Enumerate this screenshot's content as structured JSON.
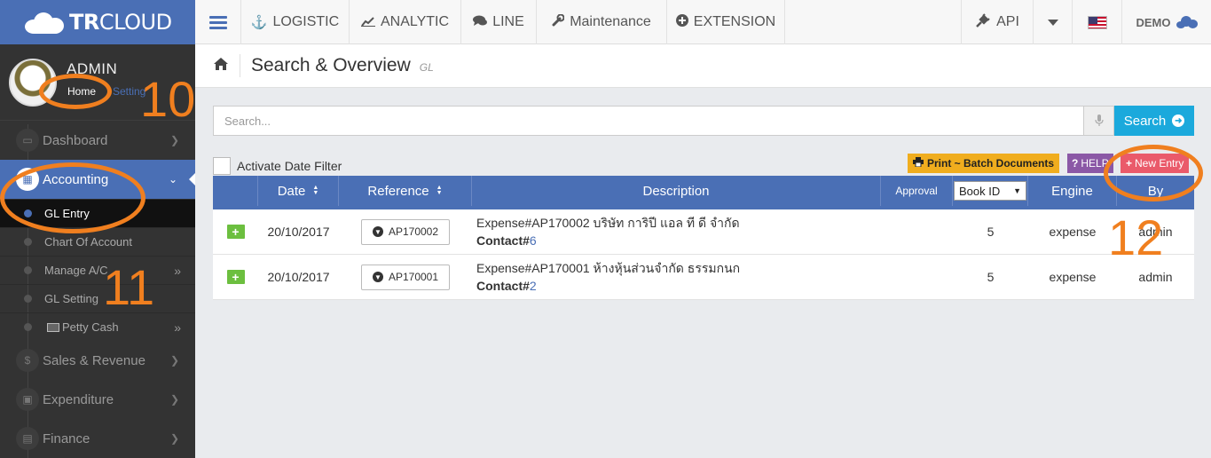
{
  "brand": {
    "name_bold": "TR",
    "name_rest": "CLOUD"
  },
  "topnav": {
    "items": [
      {
        "icon": "ship-icon",
        "label": "LOGISTIC"
      },
      {
        "icon": "chart-line-icon",
        "label": "ANALYTIC"
      },
      {
        "icon": "comments-icon",
        "label": "LINE"
      },
      {
        "icon": "wrench-icon",
        "label": "Maintenance"
      },
      {
        "icon": "plus-circle-icon",
        "label": "EXTENSION"
      }
    ],
    "api_label": "API",
    "demo_label": "DEMO"
  },
  "profile": {
    "name": "ADMIN",
    "home_link": "Home",
    "setting_link": "Setting"
  },
  "sidebar": {
    "items": [
      {
        "label": "Dashboard",
        "icon": "monitor-icon"
      },
      {
        "label": "Accounting",
        "icon": "book-icon",
        "active": true
      },
      {
        "label": "Sales & Revenue",
        "icon": "dollar-icon"
      },
      {
        "label": "Expenditure",
        "icon": "cart-icon"
      },
      {
        "label": "Finance",
        "icon": "bank-icon"
      }
    ],
    "subitems": [
      {
        "label": "GL Entry",
        "active": true
      },
      {
        "label": "Chart Of Account"
      },
      {
        "label": "Manage A/C"
      },
      {
        "label": "GL Setting"
      },
      {
        "label": "Petty Cash"
      }
    ]
  },
  "page": {
    "title": "Search & Overview",
    "subtitle": "GL"
  },
  "search": {
    "placeholder": "Search...",
    "button_label": "Search"
  },
  "filter": {
    "label": "Activate Date Filter"
  },
  "actions": {
    "print_label": "Print ~ Batch Documents",
    "help_label": "HELP",
    "new_label": "New Entry"
  },
  "grid": {
    "headers": {
      "date": "Date",
      "reference": "Reference",
      "description": "Description",
      "approval": "Approval",
      "bookid": "Book ID",
      "engine": "Engine",
      "by": "By"
    },
    "rows": [
      {
        "date": "20/10/2017",
        "reference": "AP170002",
        "description": "Expense#AP170002 บริษัท การิปี แอล ที ดี จำกัด",
        "contact_label": "Contact#",
        "contact_id": "6",
        "bookid": "5",
        "engine": "expense",
        "by": "admin"
      },
      {
        "date": "20/10/2017",
        "reference": "AP170001",
        "description": "Expense#AP170001 ห้างหุ้นส่วนจำกัด ธรรมกนก",
        "contact_label": "Contact#",
        "contact_id": "2",
        "bookid": "5",
        "engine": "expense",
        "by": "admin"
      }
    ]
  },
  "annotations": {
    "n10": "10",
    "n11": "11",
    "n12": "12",
    "color": "#f07f1f"
  },
  "colors": {
    "brand": "#4a6fb5",
    "search": "#1ba9dc",
    "print": "#f0ad1e",
    "help": "#8b58a6",
    "new": "#ea5a6a",
    "plus": "#6cbf3f"
  }
}
